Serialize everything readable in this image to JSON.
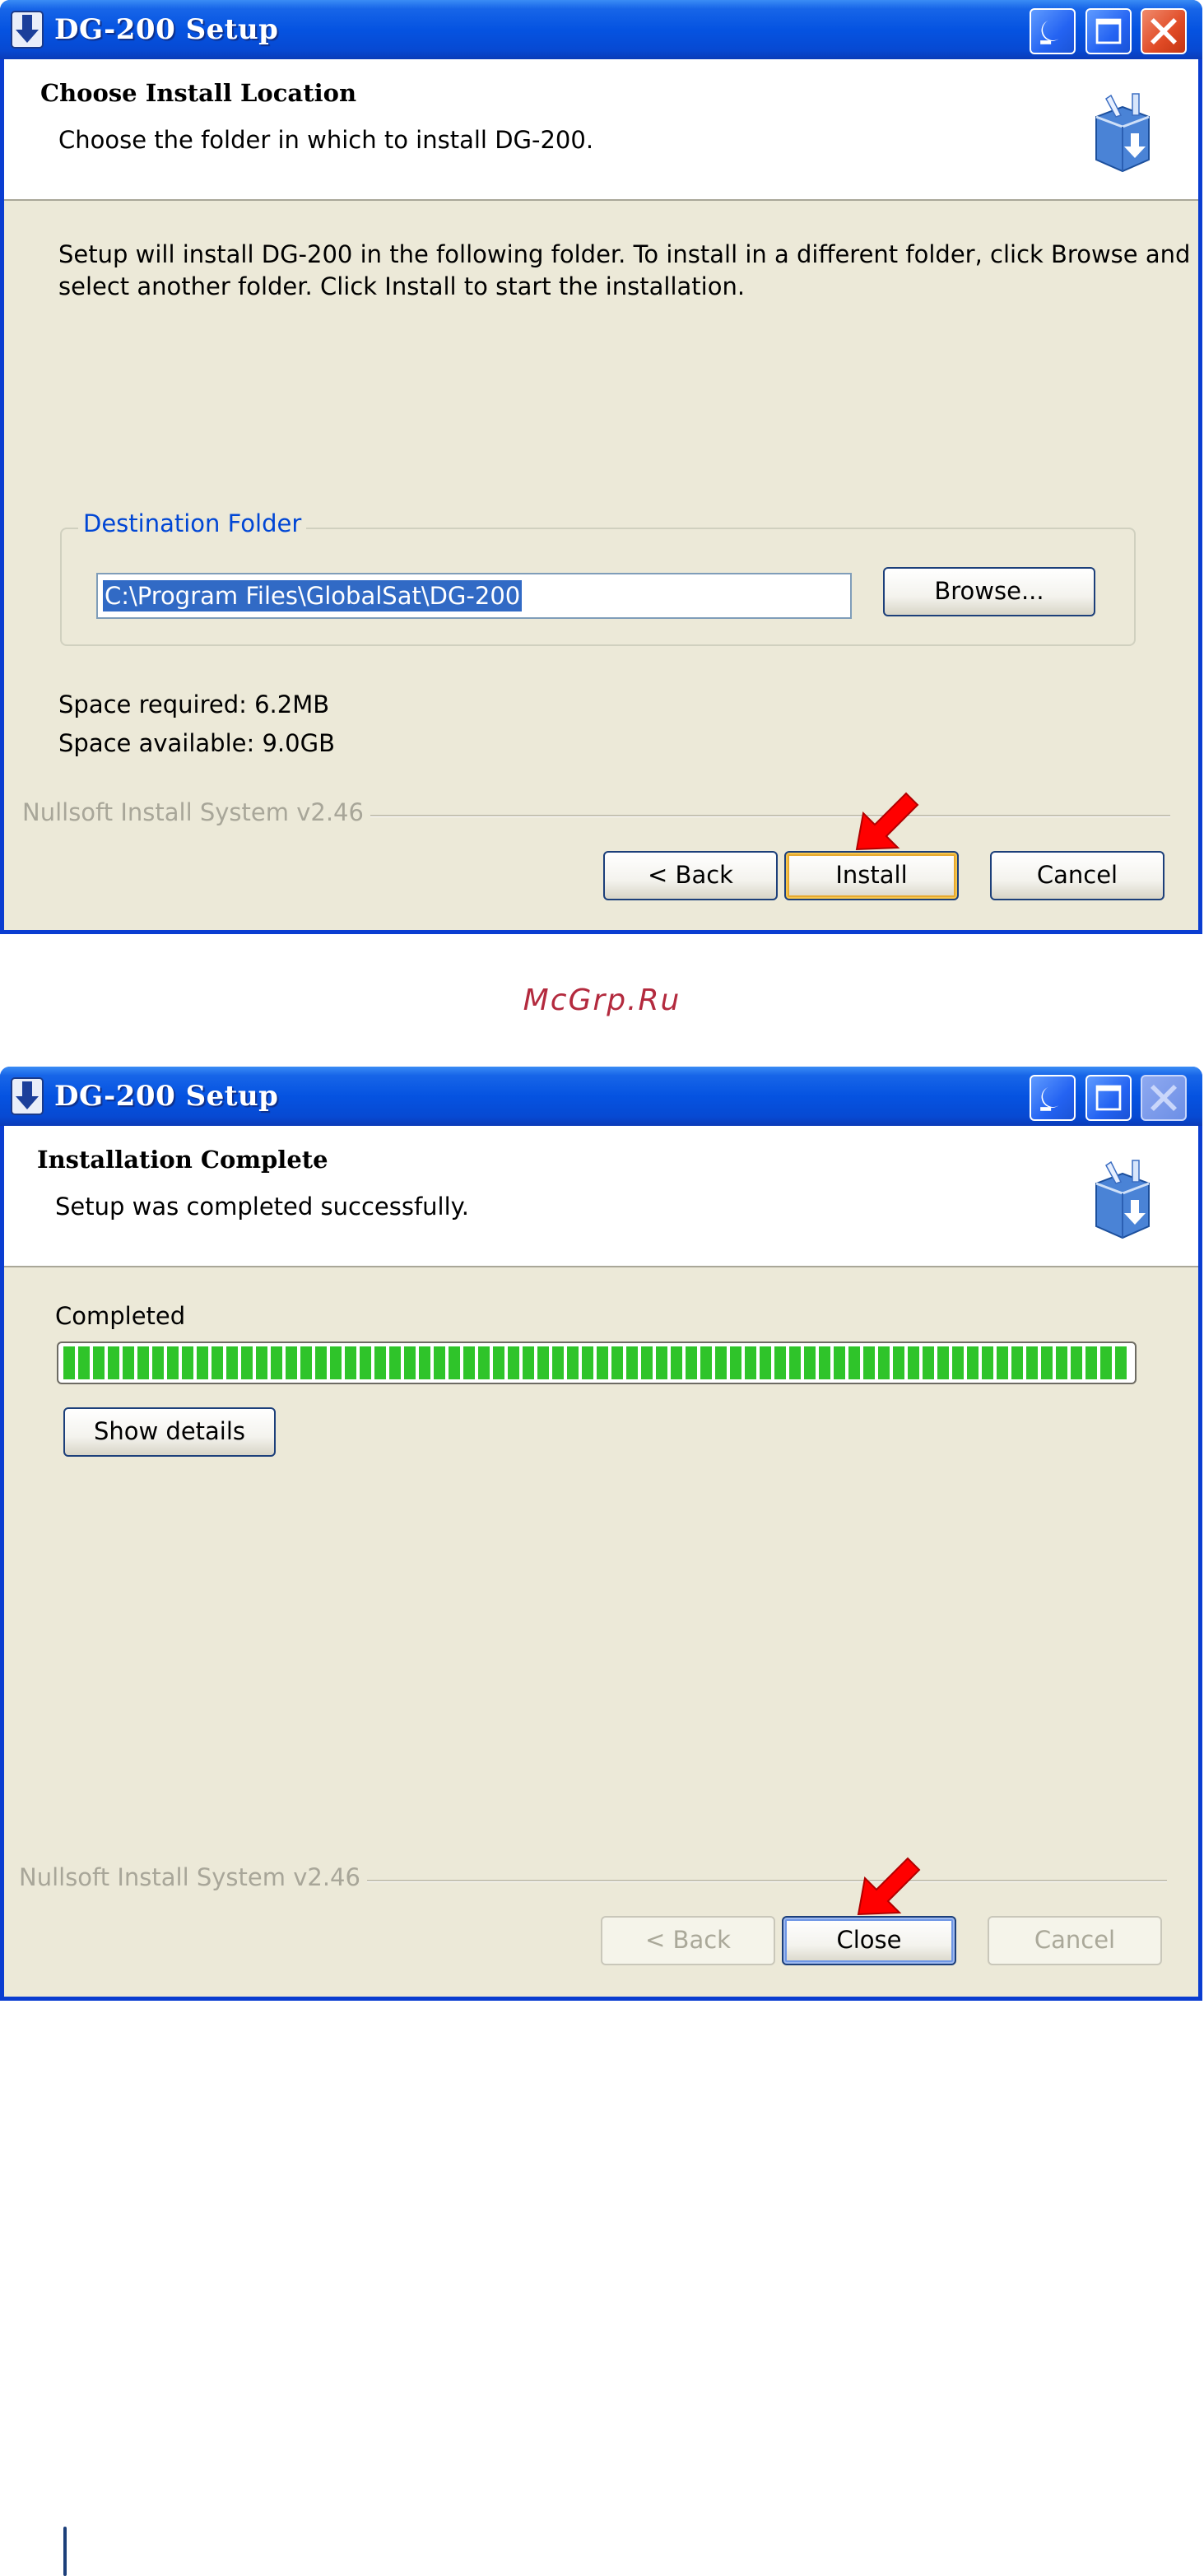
{
  "watermark": "McGrp.Ru",
  "window1": {
    "title": "DG-200 Setup",
    "header_title": "Choose Install Location",
    "header_subtitle": "Choose the folder in which to install DG-200.",
    "description_line1": "Setup will install DG-200 in the following folder. To install in a different folder, click Browse and",
    "description_line2": "select another folder. Click Install to start the installation.",
    "group_label": "Destination Folder",
    "destination_path": "C:\\Program Files\\GlobalSat\\DG-200",
    "browse_label": "Browse...",
    "space_required": "Space required: 6.2MB",
    "space_available": "Space available: 9.0GB",
    "branding": "Nullsoft Install System v2.46",
    "back_label": "< Back",
    "install_label": "Install",
    "cancel_label": "Cancel"
  },
  "window2": {
    "title": "DG-200 Setup",
    "header_title": "Installation Complete",
    "header_subtitle": "Setup was completed successfully.",
    "status_label": "Completed",
    "progress": 1.0,
    "show_details_label": "Show details",
    "branding": "Nullsoft Install System v2.46",
    "back_label": "< Back",
    "close_label": "Close",
    "cancel_label": "Cancel"
  },
  "colors": {
    "titlebar": "#0553e1",
    "client_bg": "#ece9d8",
    "progress_green": "#2fc42a",
    "arrow_red": "#ff0000",
    "watermark": "#b32a3e"
  },
  "icons": [
    "installer-download-icon",
    "minimize-icon",
    "maximize-icon",
    "close-icon",
    "setup-box-icon",
    "red-pointer-arrow-icon"
  ]
}
